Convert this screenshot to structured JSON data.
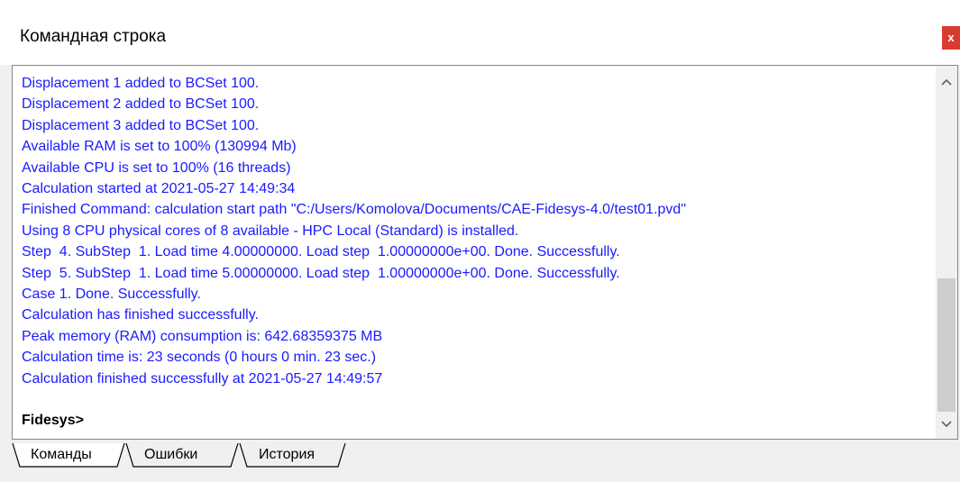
{
  "window": {
    "title": "Командная строка",
    "close_label": "x"
  },
  "console": {
    "lines": [
      "Displacement 1 added to BCSet 100.",
      "Displacement 2 added to BCSet 100.",
      "Displacement 3 added to BCSet 100.",
      "Available RAM is set to 100% (130994 Mb)",
      "Available CPU is set to 100% (16 threads)",
      "Calculation started at 2021-05-27 14:49:34",
      "Finished Command: calculation start path \"C:/Users/Komolova/Documents/CAE-Fidesys-4.0/test01.pvd\"",
      "Using 8 CPU physical cores of 8 available - HPC Local (Standard) is installed.",
      "Step  4. SubStep  1. Load time 4.00000000. Load step  1.00000000e+00. Done. Successfully.",
      "Step  5. SubStep  1. Load time 5.00000000. Load step  1.00000000e+00. Done. Successfully.",
      "Case 1. Done. Successfully.",
      "Calculation has finished successfully.",
      "Peak memory (RAM) consumption is: 642.68359375 MB",
      "Calculation time is: 23 seconds (0 hours 0 min. 23 sec.)",
      "Calculation finished successfully at 2021-05-27 14:49:57"
    ],
    "prompt": "Fidesys>",
    "text_color": "#1a1aff"
  },
  "tabs": [
    {
      "label": "Команды",
      "active": true
    },
    {
      "label": "Ошибки",
      "active": false
    },
    {
      "label": "История",
      "active": false
    }
  ]
}
